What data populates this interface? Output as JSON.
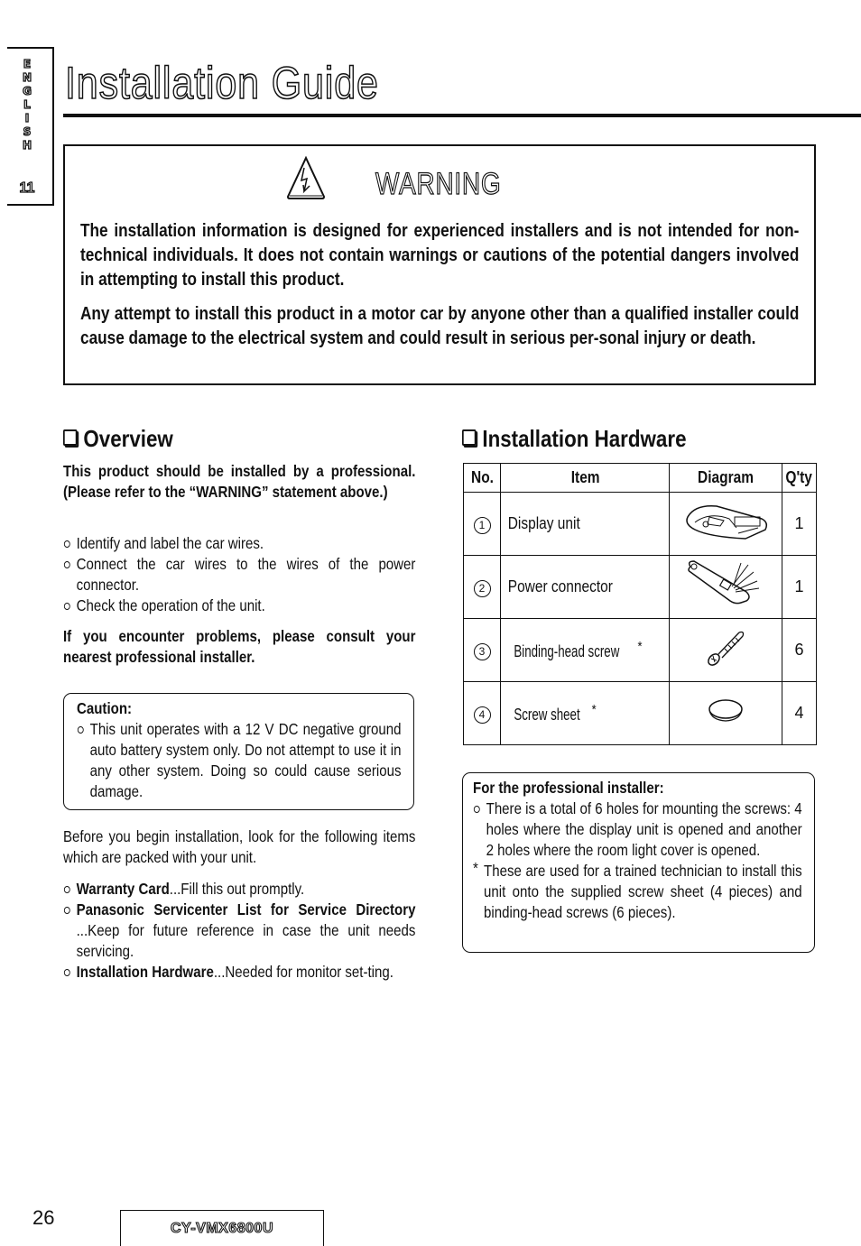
{
  "side_tab": {
    "letters": [
      "E",
      "N",
      "G",
      "L",
      "I",
      "S",
      "H"
    ],
    "number": "11"
  },
  "title": "Installation Guide",
  "warning": {
    "icon": "electric-shock-warning-icon",
    "title": "WARNING",
    "paragraphs": [
      "The installation information is designed for experienced installers and is not intended for non-technical individuals. It does not contain warnings or cautions of the potential dangers involved in attempting to install this product.",
      "Any attempt to install this product in a motor car by anyone other than a qualified installer could cause damage to the electrical system and could result in serious per-sonal injury or death."
    ]
  },
  "overview": {
    "heading": "Overview",
    "intro": "This product should be installed by a professional. (Please refer to the “WARNING” statement above.)",
    "steps": [
      "Identify and label the car wires.",
      "Connect the car wires to the wires of the power connector.",
      "Check the operation of the unit."
    ],
    "problem_note": "If you encounter problems, please consult your nearest professional installer.",
    "caution": {
      "label": "Caution:",
      "text": "This unit operates with a 12 V DC negative ground auto battery system only. Do not attempt to use it in any other system. Doing so could cause serious damage."
    },
    "packed_intro": "Before you begin installation, look for the following items which are packed with your unit.",
    "packed_items": [
      {
        "name": "Warranty Card",
        "desc": "...Fill this out promptly."
      },
      {
        "name": "Panasonic Servicenter List for Service Directory",
        "desc": "...Keep for future reference in case the unit needs servicing."
      },
      {
        "name": "Installation Hardware",
        "desc": "...Needed for monitor set-ting."
      }
    ]
  },
  "hardware": {
    "heading": "Installation Hardware",
    "columns": [
      "No.",
      "Item",
      "Diagram",
      "Q'ty"
    ],
    "rows": [
      {
        "no": "1",
        "item": "Display unit",
        "asterisk": "",
        "diagram": "display-unit-diagram",
        "qty": "1"
      },
      {
        "no": "2",
        "item": "Power connector",
        "asterisk": "",
        "diagram": "power-connector-diagram",
        "qty": "1"
      },
      {
        "no": "3",
        "item": "Binding-head screw",
        "asterisk": "*",
        "diagram": "binding-head-screw-diagram",
        "qty": "6"
      },
      {
        "no": "4",
        "item": "Screw sheet",
        "asterisk": "*",
        "diagram": "screw-sheet-diagram",
        "qty": "4"
      }
    ],
    "pro_note": {
      "label": "For the professional installer:",
      "bullet": "There is a total of 6 holes for mounting the screws: 4 holes where the display unit is opened and another 2 holes where the room light cover is opened.",
      "star_note": "These are used for a trained technician to install this unit onto the supplied screw sheet (4 pieces) and binding-head screws (6 pieces)."
    }
  },
  "footer": {
    "page_number": "26",
    "model": "CY-VMX6800U"
  }
}
